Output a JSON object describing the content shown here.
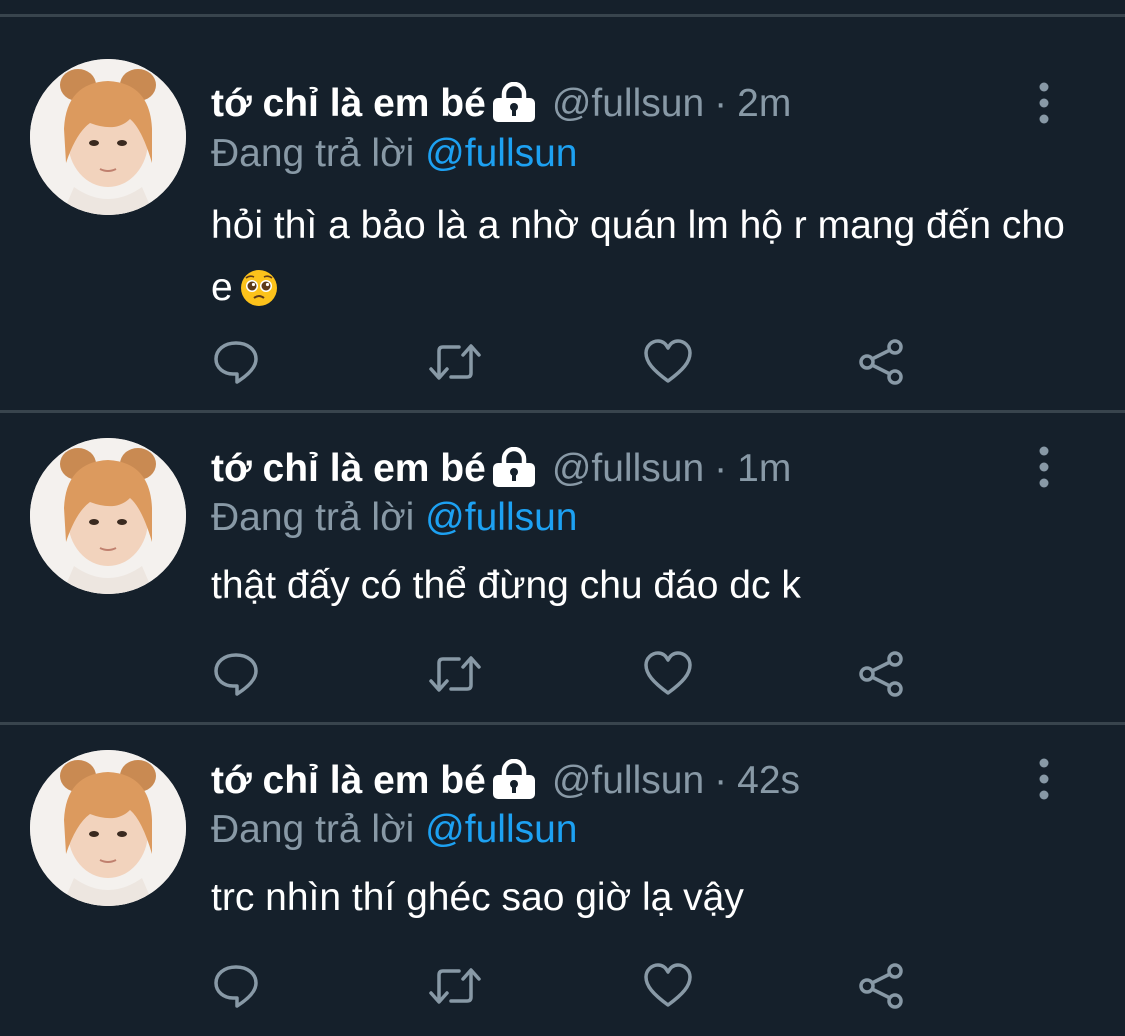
{
  "tweets": [
    {
      "name": "tớ chỉ là em bé",
      "handle": "@fullsun",
      "separator": "·",
      "time": "2m",
      "reply_prefix": "Đang trả lời",
      "reply_mention": "@fullsun",
      "text": "hỏi thì a bảo là a nhờ quán lm hộ r mang đến cho e",
      "emoji": "pleading-face"
    },
    {
      "name": "tớ chỉ là em bé",
      "handle": "@fullsun",
      "separator": "·",
      "time": "1m",
      "reply_prefix": "Đang trả lời",
      "reply_mention": "@fullsun",
      "text": "thật đấy có thể đừng chu đáo dc k"
    },
    {
      "name": "tớ chỉ là em bé",
      "handle": "@fullsun",
      "separator": "·",
      "time": "42s",
      "reply_prefix": "Đang trả lời",
      "reply_mention": "@fullsun",
      "text": "trc nhìn thí ghéc sao giờ lạ vậy"
    }
  ],
  "icons": {
    "lock": "lock-icon",
    "more": "more-vertical-icon",
    "reply": "reply-icon",
    "retweet": "retweet-icon",
    "like": "heart-icon",
    "share": "share-icon"
  },
  "colors": {
    "background": "#15202b",
    "divider": "#38444d",
    "text_primary": "#ffffff",
    "text_secondary": "#8899a6",
    "mention": "#1da1f2"
  }
}
